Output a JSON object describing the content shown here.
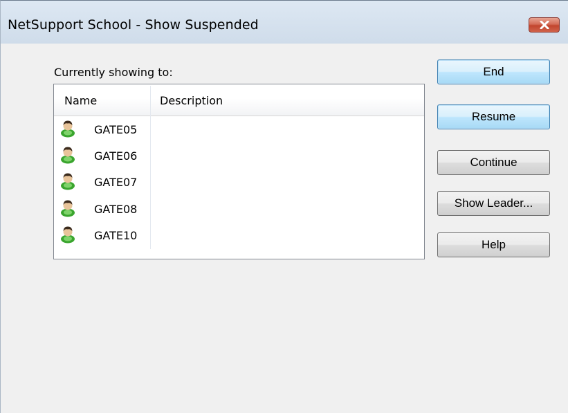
{
  "window": {
    "title": "NetSupport School - Show Suspended",
    "close_glyph": "close-icon"
  },
  "list": {
    "label": "Currently showing to:",
    "columns": [
      "Name",
      "Description"
    ],
    "rows": [
      {
        "name": "GATE05",
        "description": "",
        "icon": "student-icon"
      },
      {
        "name": "GATE06",
        "description": "",
        "icon": "student-icon"
      },
      {
        "name": "GATE07",
        "description": "",
        "icon": "student-icon"
      },
      {
        "name": "GATE08",
        "description": "",
        "icon": "student-icon"
      },
      {
        "name": "GATE10",
        "description": "",
        "icon": "student-icon"
      }
    ]
  },
  "buttons": {
    "end": "End",
    "resume": "Resume",
    "continue": "Continue",
    "show_leader": "Show Leader...",
    "help": "Help"
  },
  "colors": {
    "accent_blue": "#3c7fb1",
    "close_red": "#c1452e",
    "icon_green": "#3aa52e"
  }
}
